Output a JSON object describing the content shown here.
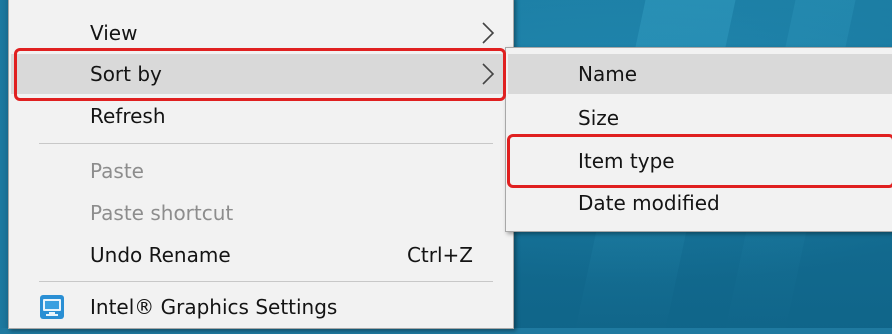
{
  "context_menu": {
    "items": [
      {
        "label": "View",
        "has_submenu": true,
        "disabled": false
      },
      {
        "label": "Sort by",
        "has_submenu": true,
        "disabled": false,
        "highlighted": true
      },
      {
        "label": "Refresh",
        "has_submenu": false,
        "disabled": false
      },
      {
        "label": "Paste",
        "has_submenu": false,
        "disabled": true
      },
      {
        "label": "Paste shortcut",
        "has_submenu": false,
        "disabled": true
      },
      {
        "label": "Undo Rename",
        "shortcut": "Ctrl+Z",
        "has_submenu": false,
        "disabled": false
      },
      {
        "label": "Intel® Graphics Settings",
        "icon": "intel-graphics-icon",
        "has_submenu": false,
        "disabled": false
      }
    ]
  },
  "sort_submenu": {
    "items": [
      {
        "label": "Name",
        "highlighted": true
      },
      {
        "label": "Size"
      },
      {
        "label": "Item type",
        "annotated": true
      },
      {
        "label": "Date modified"
      }
    ]
  },
  "colors": {
    "menu_background": "#f2f2f2",
    "hover_background": "#d9d9d9",
    "annotation_red": "#e02020",
    "desktop_blue": "#167198",
    "disabled_text": "#8d8d8d"
  }
}
